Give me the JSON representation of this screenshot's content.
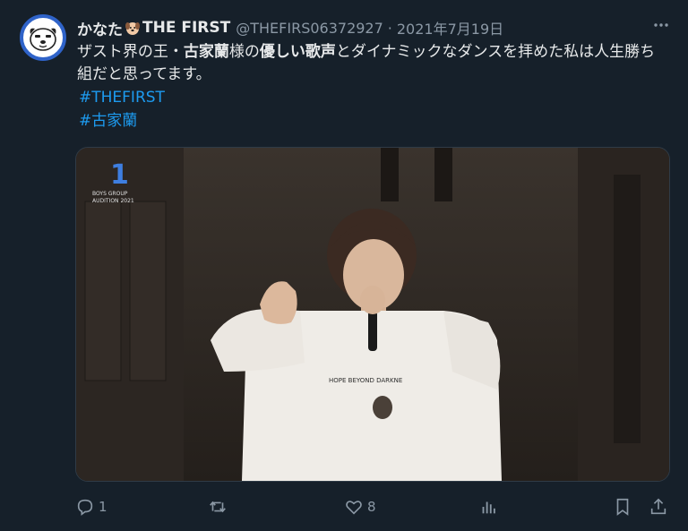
{
  "author": {
    "name_prefix": "かなた",
    "name_suffix": "THE FIRST",
    "name_emoji": "dog-face-icon",
    "handle": "@THEFIRS06372927",
    "separator": "·",
    "date": "2021年7月19日"
  },
  "tweet": {
    "text_parts": [
      "ザスト界の王・",
      "古家蘭",
      "様の",
      "優しい歌声",
      "とダイナミックなダンスを拝めた私は人生勝ち組だと思ってます。"
    ],
    "hashtags": [
      "#THEFIRST",
      "#古家蘭"
    ]
  },
  "media": {
    "logo_number": "1",
    "logo_line1": "BOYS GROUP",
    "logo_line2": "AUDITION 2021",
    "shirt_text": "HOPE BEYOND DARKNE"
  },
  "actions": {
    "reply_count": "1",
    "retweet_count": "",
    "like_count": "8"
  },
  "colors": {
    "background": "#16202a",
    "accent": "#1d9bf0",
    "muted": "#8b98a5",
    "text": "#e7e9ea"
  }
}
